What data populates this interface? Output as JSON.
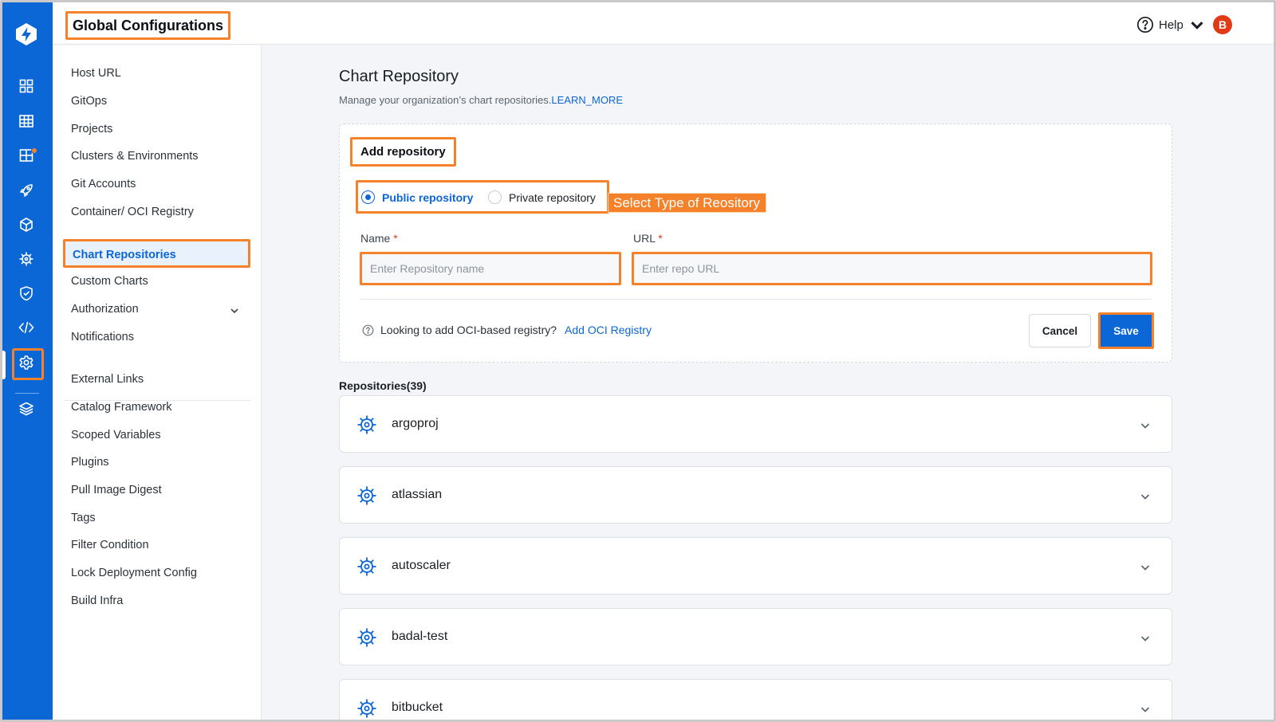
{
  "header": {
    "title": "Global Configurations",
    "help_label": "Help",
    "avatar_initial": "B"
  },
  "rail": {
    "icons": [
      "app-logo-icon",
      "overview-grid-icon",
      "applications-table-icon",
      "app-groups-icon",
      "deploy-rocket-icon",
      "resource-cube-icon",
      "helm-wheel-icon",
      "security-shield-icon",
      "code-icon",
      "settings-gear-icon",
      "stack-layers-icon"
    ],
    "active": "settings-gear-icon"
  },
  "subnav": {
    "items": [
      {
        "label": "Host URL"
      },
      {
        "label": "GitOps"
      },
      {
        "label": "Projects"
      },
      {
        "label": "Clusters & Environments"
      },
      {
        "label": "Git Accounts"
      },
      {
        "label": "Container/ OCI Registry"
      },
      {
        "label": "Chart Repositories",
        "active": true
      },
      {
        "label": "Custom Charts"
      },
      {
        "label": "Authorization",
        "expandable": true
      },
      {
        "label": "Notifications"
      },
      {
        "label": "External Links"
      },
      {
        "label": "Catalog Framework"
      },
      {
        "label": "Scoped Variables"
      },
      {
        "label": "Plugins"
      },
      {
        "label": "Pull Image Digest"
      },
      {
        "label": "Tags"
      },
      {
        "label": "Filter Condition"
      },
      {
        "label": "Lock Deployment Config"
      },
      {
        "label": "Build Infra"
      }
    ]
  },
  "main": {
    "title": "Chart Repository",
    "subtitle": "Manage your organization’s chart repositories.",
    "learn_more": "LEARN_MORE",
    "form": {
      "title": "Add repository",
      "radio_public": "Public repository",
      "radio_private": "Private repository",
      "selected": "Public repository",
      "callout": "Select Type of Reository",
      "name_label": "Name",
      "name_placeholder": "Enter Repository name",
      "url_label": "URL",
      "url_placeholder": "Enter repo URL",
      "required_mark": "*",
      "oci_text": "Looking to add OCI-based registry?",
      "oci_link": "Add OCI Registry",
      "cancel": "Cancel",
      "save": "Save"
    },
    "repositories_heading": "Repositories(39)",
    "repositories": [
      "argoproj",
      "atlassian",
      "autoscaler",
      "badal-test",
      "bitbucket"
    ]
  },
  "colors": {
    "brand_blue": "#0b66d6",
    "highlight_orange": "#f5822a",
    "avatar_red": "#e13a17"
  }
}
